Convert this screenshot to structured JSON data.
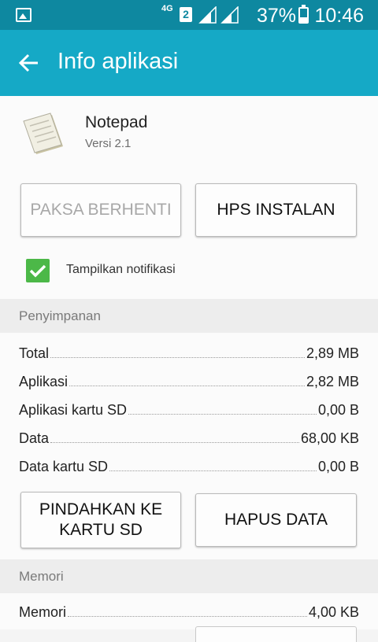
{
  "status_bar": {
    "network": "4G",
    "sim": "2",
    "battery_text": "37%",
    "battery_level": 0.37,
    "time": "10:46"
  },
  "app_bar": {
    "title": "Info aplikasi",
    "back_icon": "arrow-left-icon",
    "color": "#15a9c6"
  },
  "app": {
    "name": "Notepad",
    "version": "Versi 2.1",
    "icon": "notepad-icon"
  },
  "buttons": {
    "force_stop": "PAKSA BERHENTI",
    "uninstall": "HPS INSTALAN",
    "move_to_sd_line1": "PINDAHKAN KE",
    "move_to_sd_line2": "KARTU SD",
    "clear_data": "HAPUS DATA"
  },
  "notifications": {
    "label": "Tampilkan notifikasi",
    "checked": true,
    "color": "#4cb848"
  },
  "storage": {
    "header": "Penyimpanan",
    "rows": [
      {
        "label": "Total",
        "value": "2,89 MB"
      },
      {
        "label": "Aplikasi",
        "value": "2,82 MB"
      },
      {
        "label": "Aplikasi kartu SD",
        "value": "0,00 B"
      },
      {
        "label": "Data",
        "value": "68,00 KB"
      },
      {
        "label": "Data kartu SD",
        "value": "0,00 B"
      }
    ]
  },
  "memory": {
    "header": "Memori",
    "rows": [
      {
        "label": "Memori",
        "value": "4,00 KB"
      }
    ]
  }
}
